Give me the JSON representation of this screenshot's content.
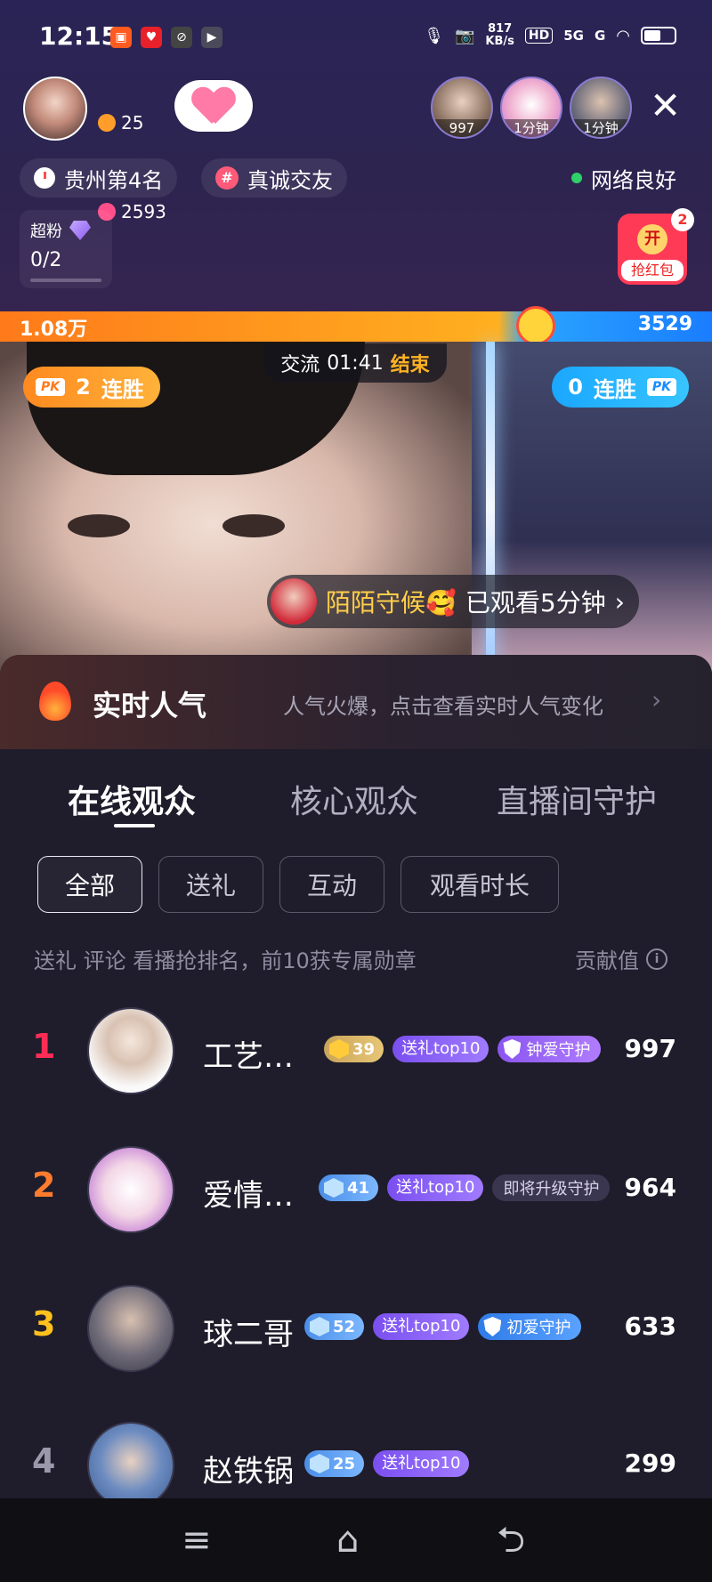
{
  "status_bar": {
    "time": "12:15",
    "speed_value": "817",
    "speed_unit": "KB/s",
    "hd": "HD",
    "net1": "5G",
    "net2": "G"
  },
  "host": {
    "fans": "25",
    "likes": "2593"
  },
  "top_viewers": [
    {
      "label": "997"
    },
    {
      "label": "1分钟"
    },
    {
      "label": "1分钟"
    }
  ],
  "chips": {
    "rank": "贵州第4名",
    "tag": "真诚交友",
    "network": "网络良好"
  },
  "superfan": {
    "title": "超粉",
    "value": "0/2"
  },
  "redpack": {
    "open": "开",
    "label": "抢红包",
    "count": "2"
  },
  "pk": {
    "left_score": "1.08万",
    "right_score": "3529",
    "mode": "交流",
    "timer": "01:41",
    "end": "结束",
    "left_streak": "2",
    "right_streak": "0",
    "streak_label": "连胜",
    "pk_tag": "PK"
  },
  "watch_banner": {
    "name": "陌陌守候🥰",
    "text": "已观看5分钟",
    "arrow": "›"
  },
  "popularity": {
    "title": "实时人气",
    "subtitle": "人气火爆，点击查看实时人气变化",
    "arrow": "›"
  },
  "tabs": [
    "在线观众",
    "核心观众",
    "直播间守护"
  ],
  "filters": [
    "全部",
    "送礼",
    "互动",
    "观看时长"
  ],
  "hint": "送礼 评论 看播抢排名，前10获专属勋章",
  "contrib_label": "贡献值",
  "viewers": [
    {
      "rank": "1",
      "name": "工艺…",
      "level": "39",
      "gift_tag": "送礼top10",
      "guard": "钟爱守护",
      "score": "997"
    },
    {
      "rank": "2",
      "name": "爱情…",
      "level": "41",
      "gift_tag": "送礼top10",
      "guard": "即将升级守护",
      "score": "964"
    },
    {
      "rank": "3",
      "name": "球二哥",
      "level": "52",
      "gift_tag": "送礼top10",
      "guard": "初爱守护",
      "score": "633"
    },
    {
      "rank": "4",
      "name": "赵铁锅",
      "level": "25",
      "gift_tag": "送礼top10",
      "score": "299"
    }
  ],
  "nav": {
    "menu": "≡",
    "home": "⌂",
    "back": "⮌"
  }
}
